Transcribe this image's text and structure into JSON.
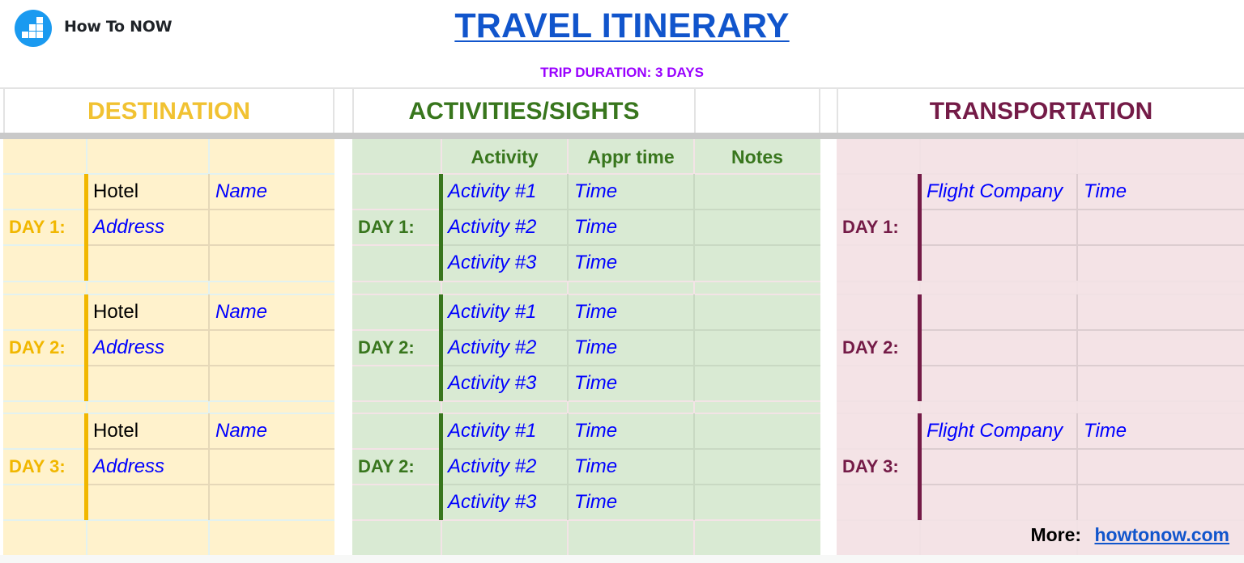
{
  "brand": {
    "logo_icon": "bar-chart-blocks-icon",
    "name": "How To NOW",
    "color": "#1a9af0"
  },
  "title": "TRAVEL ITINERARY",
  "subtitle": "TRIP DURATION: 3 DAYS",
  "colors": {
    "title": "#1155cc",
    "subtitle": "#9900ff",
    "destination": "#f1c232",
    "activities": "#38761d",
    "transportation": "#741b47",
    "placeholder_text": "#0000ff"
  },
  "sections": {
    "destination": {
      "header": "DESTINATION",
      "days": [
        {
          "label": "DAY 1:",
          "rows": [
            [
              "Hotel",
              "Name"
            ],
            [
              "Address",
              ""
            ],
            [
              "",
              ""
            ]
          ]
        },
        {
          "label": "DAY 2:",
          "rows": [
            [
              "Hotel",
              "Name"
            ],
            [
              "Address",
              ""
            ],
            [
              "",
              ""
            ]
          ]
        },
        {
          "label": "DAY 3:",
          "rows": [
            [
              "Hotel",
              "Name"
            ],
            [
              "Address",
              ""
            ],
            [
              "",
              ""
            ]
          ]
        }
      ]
    },
    "activities": {
      "header": "ACTIVITIES/SIGHTS",
      "columns": [
        "Activity",
        "Appr time",
        "Notes"
      ],
      "days": [
        {
          "label": "DAY 1:",
          "rows": [
            [
              "Activity #1",
              "Time",
              ""
            ],
            [
              "Activity #2",
              "Time",
              ""
            ],
            [
              "Activity #3",
              "Time",
              ""
            ]
          ]
        },
        {
          "label": "DAY 2:",
          "rows": [
            [
              "Activity #1",
              "Time",
              ""
            ],
            [
              "Activity #2",
              "Time",
              ""
            ],
            [
              "Activity #3",
              "Time",
              ""
            ]
          ]
        },
        {
          "label": "DAY 2:",
          "rows": [
            [
              "Activity #1",
              "Time",
              ""
            ],
            [
              "Activity #2",
              "Time",
              ""
            ],
            [
              "Activity #3",
              "Time",
              ""
            ]
          ]
        }
      ]
    },
    "transportation": {
      "header": "TRANSPORTATION",
      "days": [
        {
          "label": "DAY 1:",
          "rows": [
            [
              "Flight Company",
              "Time"
            ],
            [
              "",
              ""
            ],
            [
              "",
              ""
            ]
          ]
        },
        {
          "label": "DAY 2:",
          "rows": [
            [
              "",
              ""
            ],
            [
              "",
              ""
            ],
            [
              "",
              ""
            ]
          ]
        },
        {
          "label": "DAY 3:",
          "rows": [
            [
              "Flight Company",
              "Time"
            ],
            [
              "",
              ""
            ],
            [
              "",
              ""
            ]
          ]
        }
      ]
    }
  },
  "footer": {
    "label": "More:",
    "link": "howtonow.com"
  }
}
